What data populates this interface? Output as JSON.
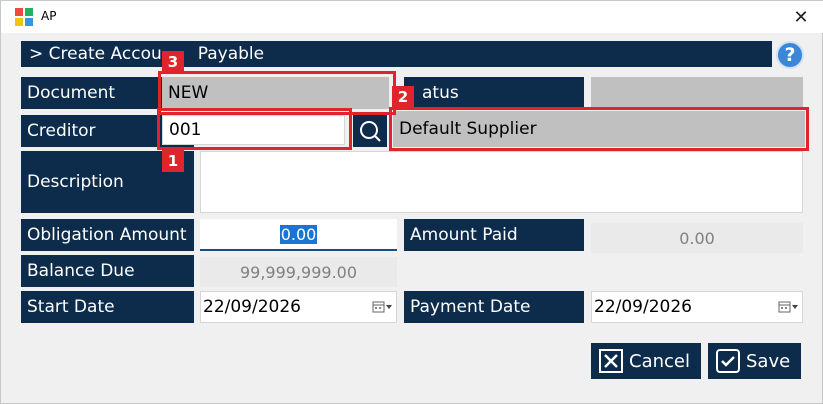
{
  "window": {
    "title": "AP",
    "close_glyph": "✕"
  },
  "header": {
    "title": "> Create Accou",
    "title_tail": "Payable",
    "help_glyph": "?"
  },
  "form": {
    "document": {
      "label": "Document",
      "value": "NEW"
    },
    "status": {
      "label": "atus",
      "value": ""
    },
    "creditor": {
      "label": "Creditor",
      "value": "001",
      "name": "Default Supplier"
    },
    "description": {
      "label": "Description",
      "value": ""
    },
    "obligation_amount": {
      "label": "Obligation Amount",
      "value": "0.00"
    },
    "amount_paid": {
      "label": "Amount Paid",
      "value": "0.00"
    },
    "balance_due": {
      "label": "Balance Due",
      "value": "99,999,999.00"
    },
    "start_date": {
      "label": "Start Date",
      "value": "22/09/2026"
    },
    "payment_date": {
      "label": "Payment Date",
      "value": "22/09/2026"
    }
  },
  "actions": {
    "cancel_label": "Cancel",
    "save_label": "Save"
  },
  "annotations": {
    "box1": "1",
    "box2": "2",
    "box3": "3",
    "color": "#e0242b"
  },
  "theme": {
    "label_bg": "#0d2b4a",
    "help_blue": "#3b86d6"
  }
}
